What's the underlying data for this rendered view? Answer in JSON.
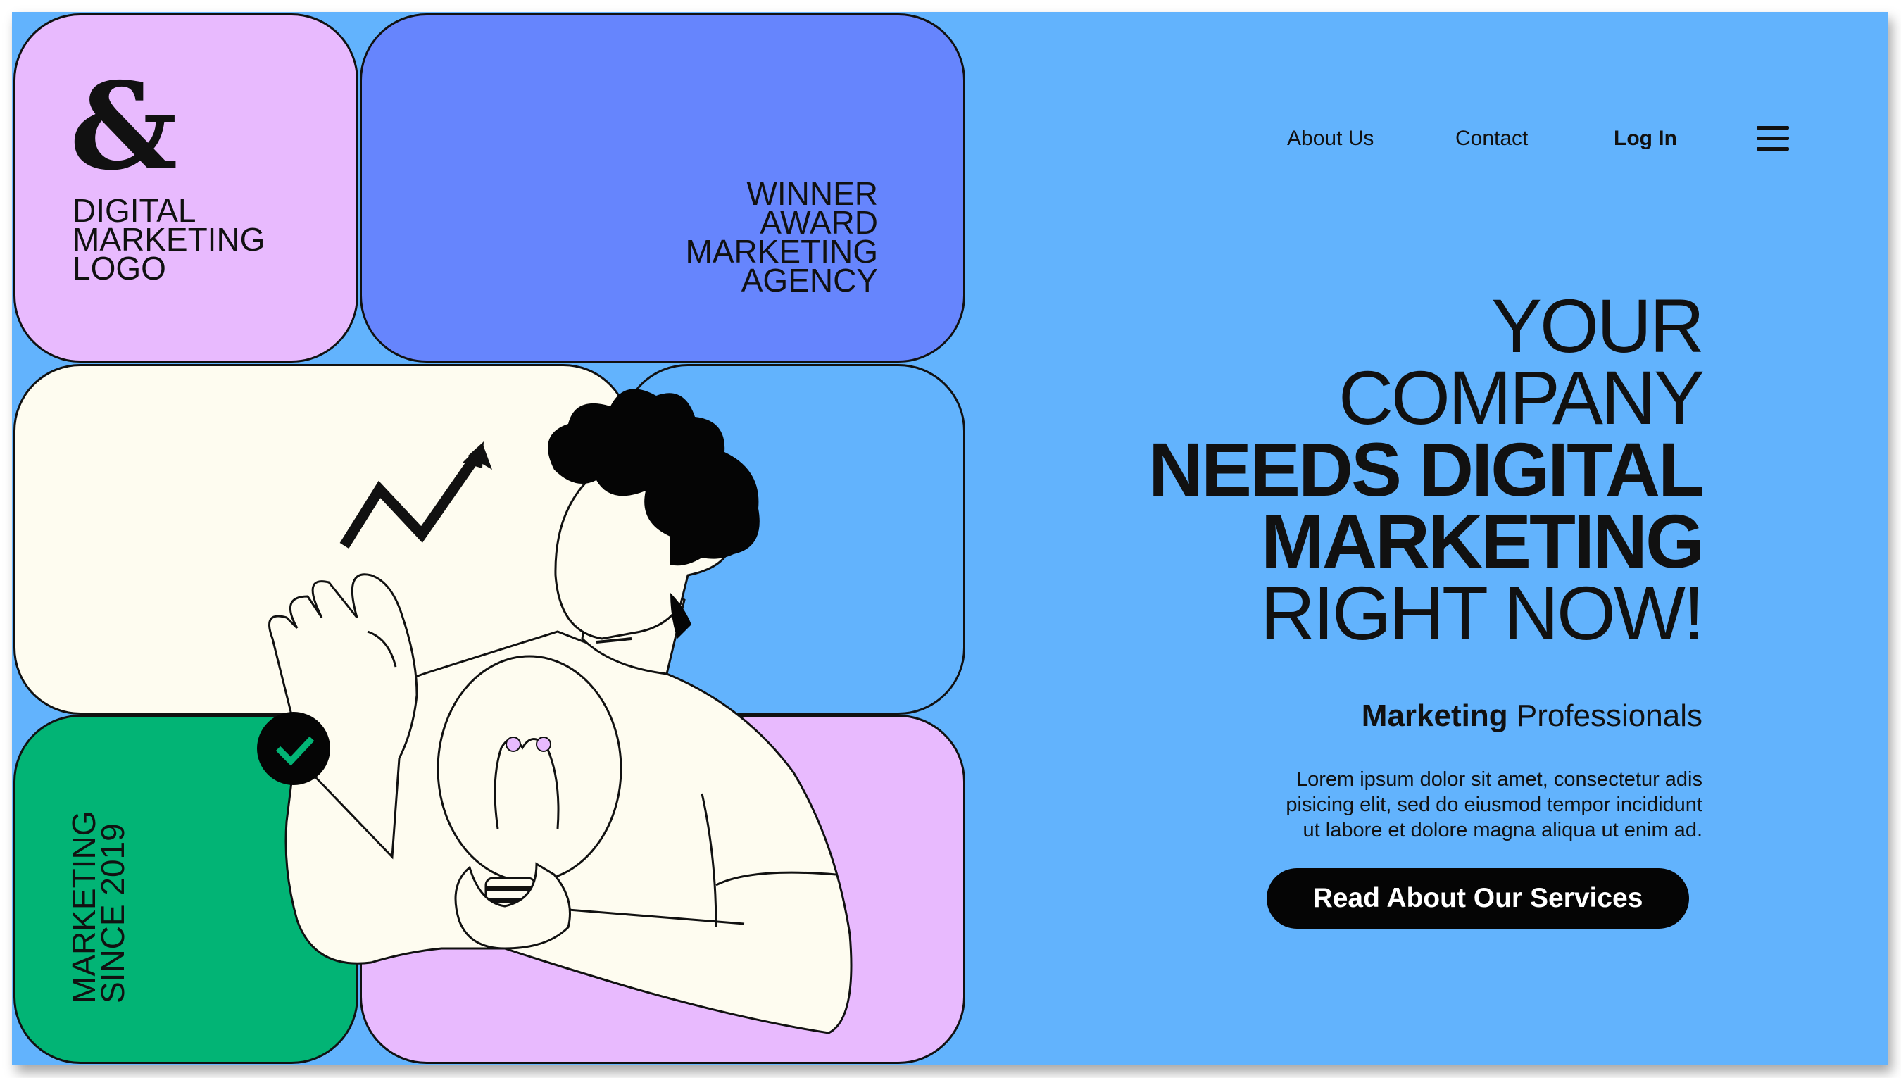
{
  "logo": {
    "symbol": "&",
    "lines": [
      "DIGITAL",
      "MARKETING",
      "LOGO"
    ]
  },
  "award": {
    "lines": [
      "WINNER",
      "AWARD",
      "MARKETING",
      "AGENCY"
    ]
  },
  "since": {
    "lines": [
      "MARKETING",
      "SINCE 2019"
    ]
  },
  "nav": {
    "about": "About Us",
    "contact": "Contact",
    "login": "Log In",
    "menu_icon": "hamburger-menu-icon"
  },
  "hero": {
    "headline": {
      "line1": "YOUR",
      "line2": "COMPANY",
      "line3": "NEEDS DIGITAL",
      "line4": "MARKETING",
      "line5": "RIGHT NOW!"
    },
    "subhead_bold": "Marketing",
    "subhead_light": "Professionals",
    "body_lines": [
      "Lorem ipsum dolor sit amet, consectetur adis",
      "pisicing elit, sed do eiusmod tempor incididunt",
      "ut labore et dolore magna aliqua ut enim ad."
    ],
    "cta": "Read About Our Services"
  },
  "colors": {
    "background": "#62b3fd",
    "lavender": "#e8bafe",
    "periwinkle": "#6685fd",
    "green": "#02b475",
    "cream": "#fefcf0",
    "ink": "#111111"
  }
}
